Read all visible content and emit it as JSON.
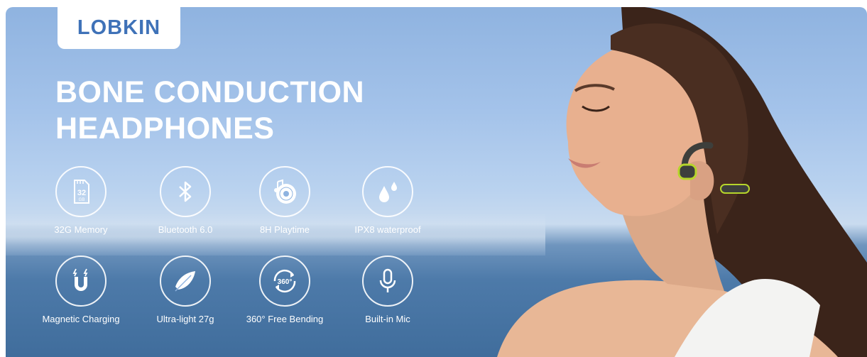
{
  "brand": {
    "logo": "LOBKIN"
  },
  "headline": {
    "line1": "BONE CONDUCTION",
    "line2": "HEADPHONES"
  },
  "features": [
    {
      "label": "32G Memory",
      "icon": "sd-card-icon",
      "badge_num": "32",
      "badge_unit": "GB"
    },
    {
      "label": "Bluetooth 6.0",
      "icon": "bluetooth-icon"
    },
    {
      "label": "8H Playtime",
      "icon": "music-disc-icon"
    },
    {
      "label": "IPX8 waterproof",
      "icon": "water-drops-icon"
    },
    {
      "label": "Magnetic Charging",
      "icon": "magnet-icon"
    },
    {
      "label": "Ultra-light 27g",
      "icon": "feather-icon"
    },
    {
      "label": "360° Free Bending",
      "icon": "rotate-360-icon",
      "badge_num": "360°"
    },
    {
      "label": "Built-in Mic",
      "icon": "microphone-icon"
    }
  ],
  "colors": {
    "brand_blue": "#3f72b8",
    "sky": "#a4c3ea",
    "sea": "#4d7aa9",
    "accent_green": "#b6d52b"
  }
}
